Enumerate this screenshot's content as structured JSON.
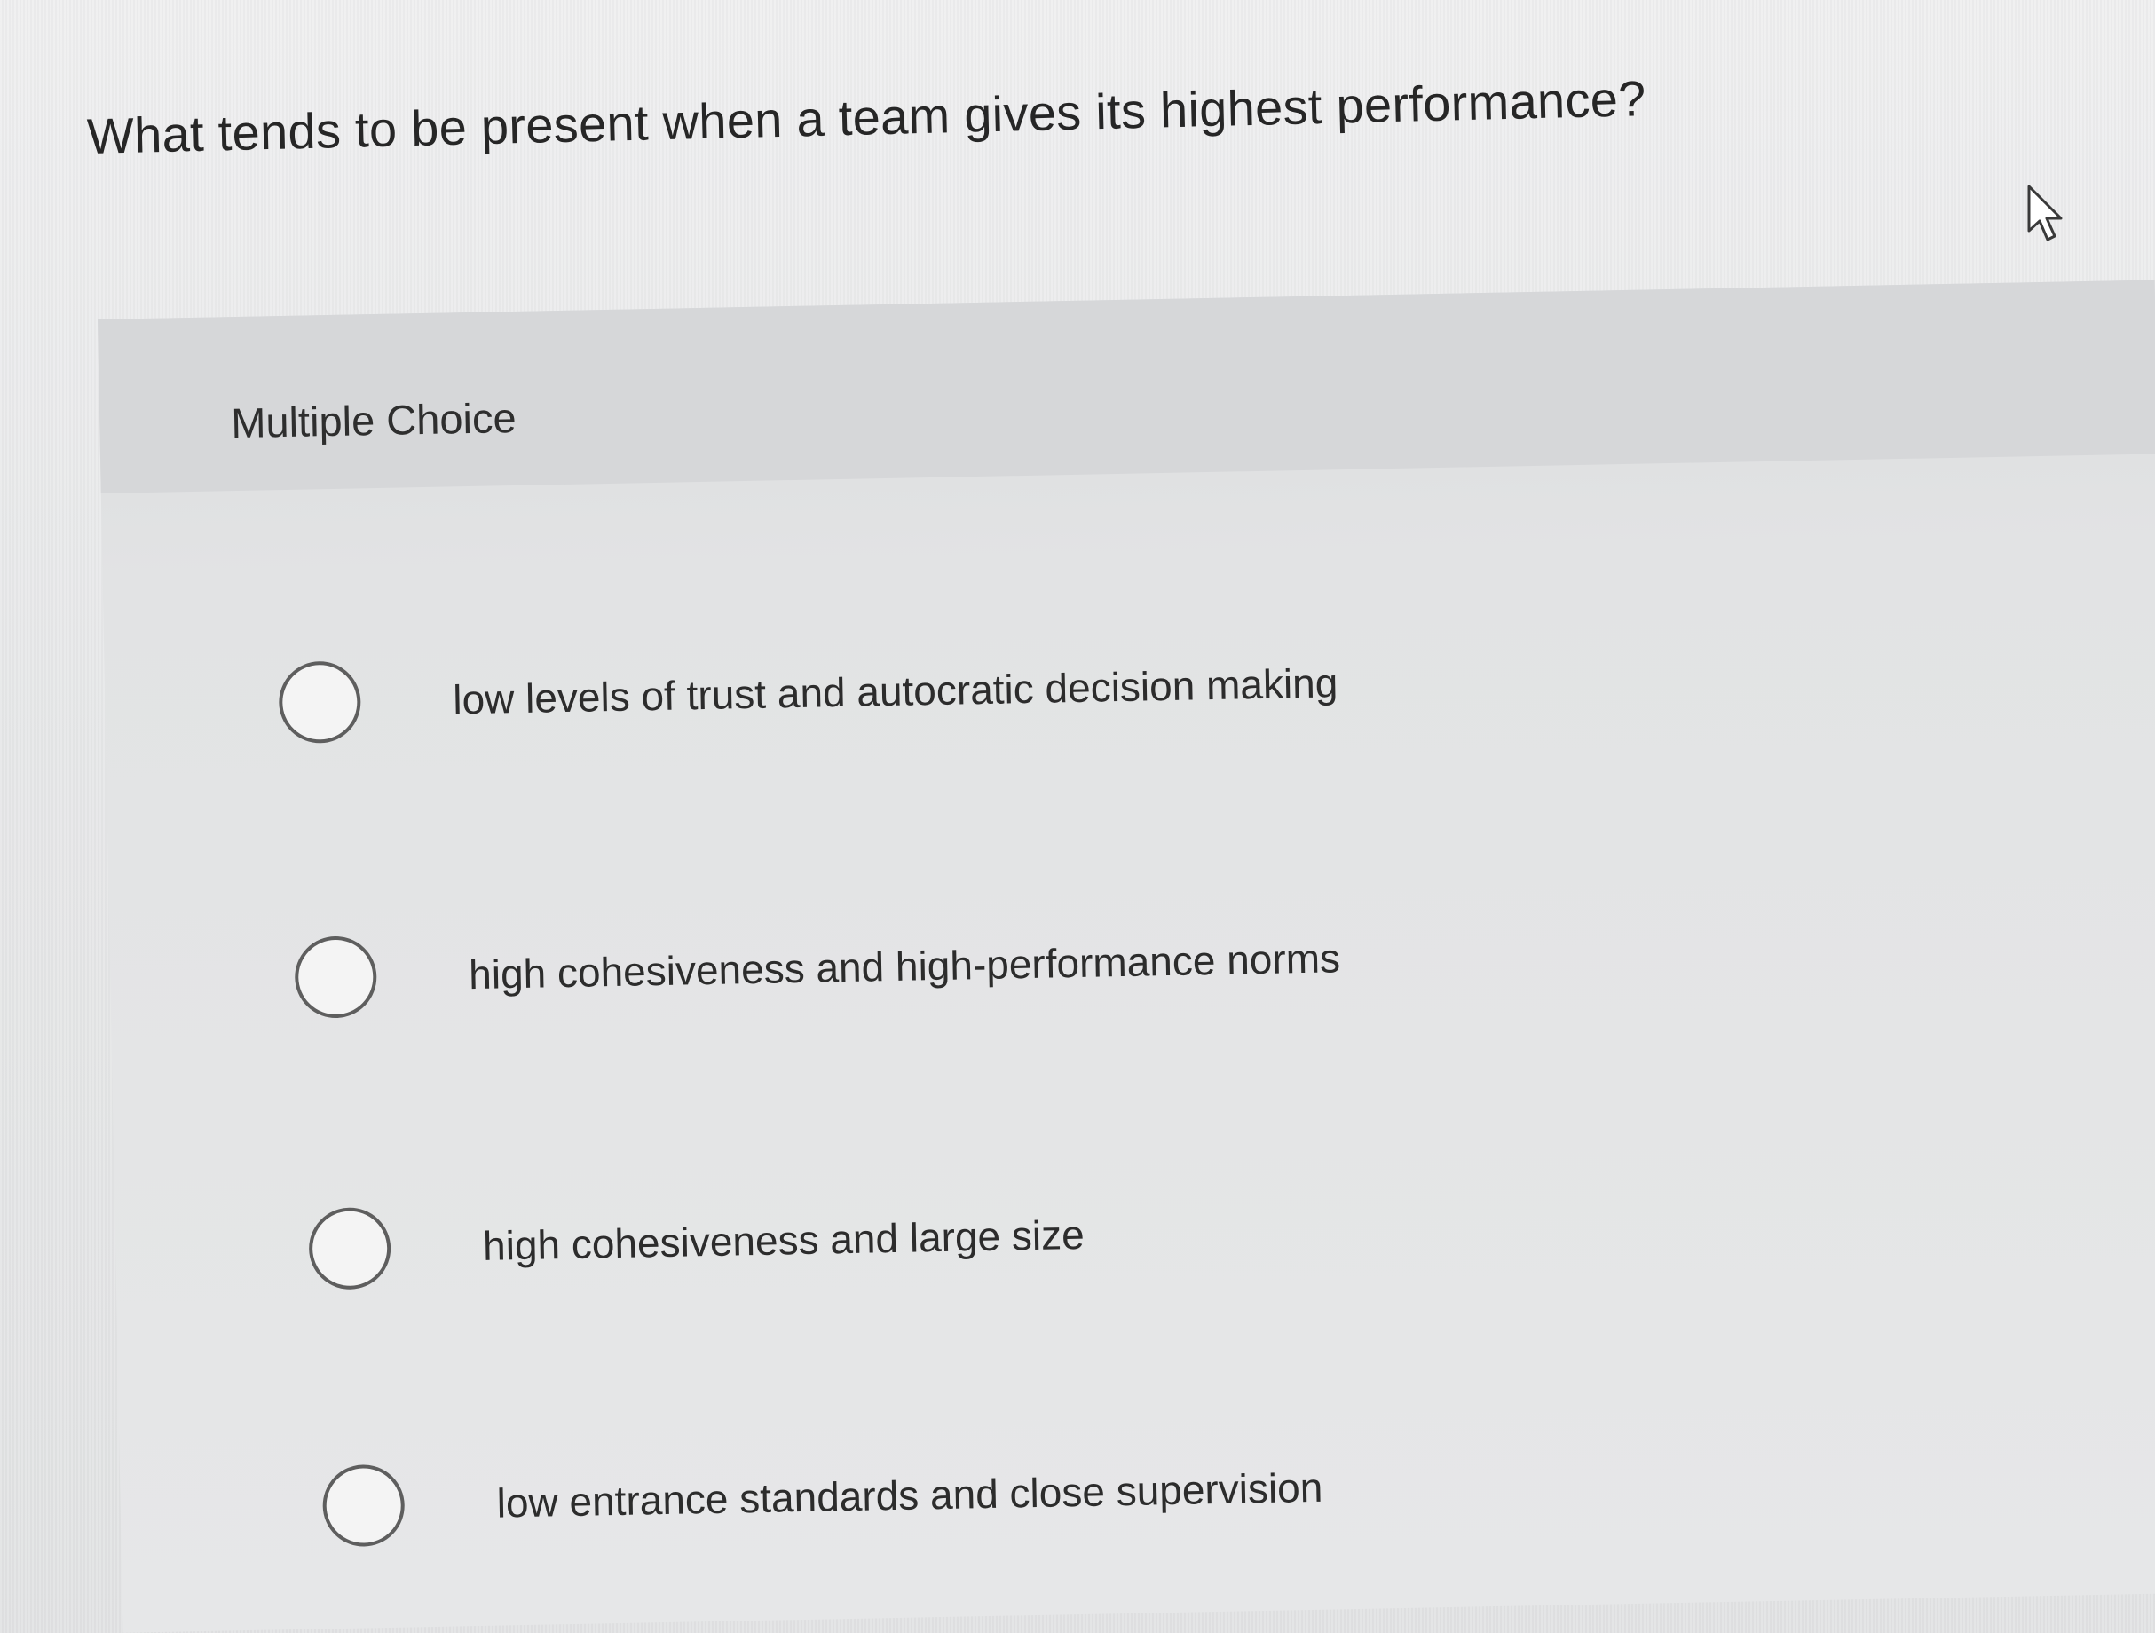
{
  "question": {
    "text": "What tends to be present when a team gives its highest performance?"
  },
  "answer_panel": {
    "type_label": "Multiple Choice",
    "options": [
      {
        "label": "low levels of trust and autocratic decision making",
        "selected": false
      },
      {
        "label": "high cohesiveness and high-performance norms",
        "selected": false
      },
      {
        "label": "high cohesiveness and large size",
        "selected": false
      },
      {
        "label": "low entrance standards and close supervision",
        "selected": false
      }
    ]
  },
  "cursor": {
    "icon": "arrow-cursor-icon"
  },
  "colors": {
    "background": "#e9eaeb",
    "panel": "#e2e3e4",
    "panel_header": "#d6d7d9",
    "text": "#2b2b2b",
    "radio_border": "#5e5e5e"
  }
}
